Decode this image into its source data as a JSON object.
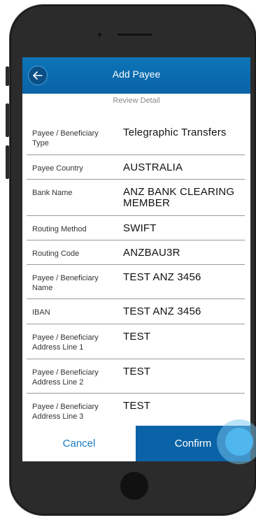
{
  "header": {
    "title": "Add Payee"
  },
  "subtitle": "Review Detail",
  "rows": [
    {
      "label": "Payee / Beneficiary Type",
      "value": "Telegraphic Transfers"
    },
    {
      "label": "Payee Country",
      "value": "AUSTRALIA"
    },
    {
      "label": "Bank Name",
      "value": "ANZ BANK CLEARING MEMBER"
    },
    {
      "label": "Routing Method",
      "value": "SWIFT"
    },
    {
      "label": "Routing Code",
      "value": "ANZBAU3R"
    },
    {
      "label": "Payee / Beneficiary Name",
      "value": "TEST ANZ 3456"
    },
    {
      "label": "IBAN",
      "value": "TEST ANZ 3456"
    },
    {
      "label": "Payee / Beneficiary Address Line 1",
      "value": "TEST"
    },
    {
      "label": "Payee / Beneficiary Address Line 2",
      "value": "TEST"
    },
    {
      "label": "Payee / Beneficiary Address Line 3",
      "value": "TEST"
    }
  ],
  "footer": {
    "cancel_label": "Cancel",
    "confirm_label": "Confirm"
  },
  "icons": {
    "back": "arrow-left-icon"
  },
  "colors": {
    "brand_blue": "#0a63a6",
    "link_blue": "#1a7cc1",
    "touch_indicator": "#4fb6ee"
  }
}
